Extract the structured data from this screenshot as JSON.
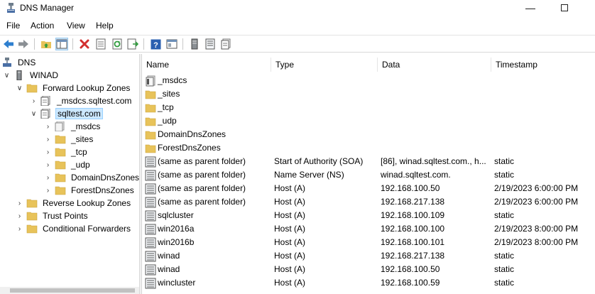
{
  "window": {
    "title": "DNS Manager"
  },
  "menu": [
    "File",
    "Action",
    "View",
    "Help"
  ],
  "toolbar": {
    "buttons": [
      "back-icon",
      "forward-icon",
      "up-folder-icon",
      "show-hide-tree-icon",
      "delete-icon",
      "properties-icon",
      "refresh-icon",
      "export-list-icon",
      "help-icon",
      "console-icon",
      "server-icon",
      "records-icon",
      "zone-icon"
    ]
  },
  "tree": {
    "root": "DNS",
    "server": "WINAD",
    "forward_zones": "Forward Lookup Zones",
    "msdcs_zone": "_msdcs.sqltest.com",
    "sqltest_zone": "sqltest.com",
    "sub": [
      "_msdcs",
      "_sites",
      "_tcp",
      "_udp",
      "DomainDnsZones",
      "ForestDnsZones"
    ],
    "reverse_zones": "Reverse Lookup Zones",
    "trust_points": "Trust Points",
    "conditional_forwarders": "Conditional Forwarders"
  },
  "columns": {
    "name": "Name",
    "type": "Type",
    "data": "Data",
    "timestamp": "Timestamp"
  },
  "rows": [
    {
      "icon": "delegation-icon",
      "name": "_msdcs",
      "type": "",
      "data": "",
      "timestamp": ""
    },
    {
      "icon": "folder-icon",
      "name": "_sites",
      "type": "",
      "data": "",
      "timestamp": ""
    },
    {
      "icon": "folder-icon",
      "name": "_tcp",
      "type": "",
      "data": "",
      "timestamp": ""
    },
    {
      "icon": "folder-icon",
      "name": "_udp",
      "type": "",
      "data": "",
      "timestamp": ""
    },
    {
      "icon": "folder-icon",
      "name": "DomainDnsZones",
      "type": "",
      "data": "",
      "timestamp": ""
    },
    {
      "icon": "folder-icon",
      "name": "ForestDnsZones",
      "type": "",
      "data": "",
      "timestamp": ""
    },
    {
      "icon": "record-icon",
      "name": "(same as parent folder)",
      "type": "Start of Authority (SOA)",
      "data": "[86], winad.sqltest.com., h...",
      "timestamp": "static"
    },
    {
      "icon": "record-icon",
      "name": "(same as parent folder)",
      "type": "Name Server (NS)",
      "data": "winad.sqltest.com.",
      "timestamp": "static"
    },
    {
      "icon": "record-icon",
      "name": "(same as parent folder)",
      "type": "Host (A)",
      "data": "192.168.100.50",
      "timestamp": "2/19/2023 6:00:00 PM"
    },
    {
      "icon": "record-icon",
      "name": "(same as parent folder)",
      "type": "Host (A)",
      "data": "192.168.217.138",
      "timestamp": "2/19/2023 6:00:00 PM"
    },
    {
      "icon": "record-icon",
      "name": "sqlcluster",
      "type": "Host (A)",
      "data": "192.168.100.109",
      "timestamp": "static"
    },
    {
      "icon": "record-icon",
      "name": "win2016a",
      "type": "Host (A)",
      "data": "192.168.100.100",
      "timestamp": "2/19/2023 8:00:00 PM"
    },
    {
      "icon": "record-icon",
      "name": "win2016b",
      "type": "Host (A)",
      "data": "192.168.100.101",
      "timestamp": "2/19/2023 8:00:00 PM"
    },
    {
      "icon": "record-icon",
      "name": "winad",
      "type": "Host (A)",
      "data": "192.168.217.138",
      "timestamp": "static"
    },
    {
      "icon": "record-icon",
      "name": "winad",
      "type": "Host (A)",
      "data": "192.168.100.50",
      "timestamp": "static"
    },
    {
      "icon": "record-icon",
      "name": "wincluster",
      "type": "Host (A)",
      "data": "192.168.100.59",
      "timestamp": "static"
    }
  ],
  "colors": {
    "selection": "#cce8ff",
    "folder": "#e8c35a",
    "toolbar_pressed": "#cce4f7"
  }
}
